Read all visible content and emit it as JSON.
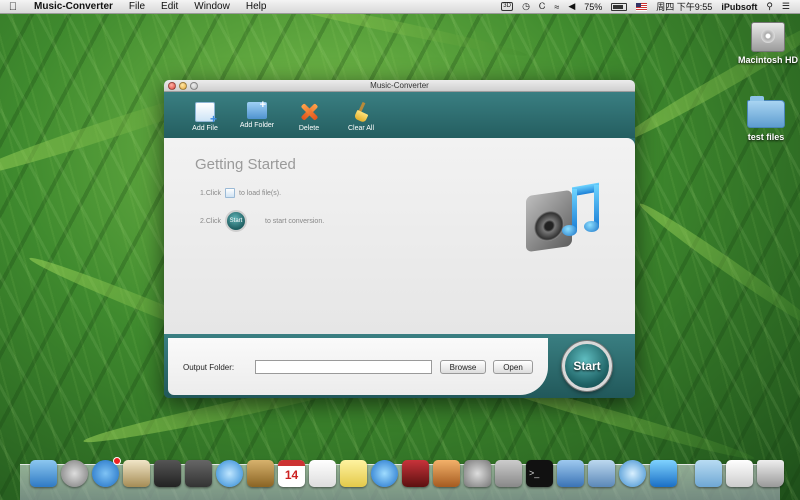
{
  "menubar": {
    "app_name": "Music-Converter",
    "menus": [
      "File",
      "Edit",
      "Window",
      "Help"
    ],
    "battery": "75%",
    "clock": "周四 下午9:55",
    "user": "iPubsoft",
    "search_icon": "magnifier-icon"
  },
  "desktop": {
    "icons": [
      {
        "label": "Macintosh HD",
        "icon": "hard-drive-icon"
      },
      {
        "label": "test files",
        "icon": "folder-icon"
      }
    ]
  },
  "window": {
    "title": "Music-Converter",
    "toolbar": {
      "add_file": "Add File",
      "add_folder": "Add Folder",
      "delete": "Delete",
      "clear_all": "Clear All"
    },
    "getting_started": {
      "title": "Getting Started",
      "step1_prefix": "1.Click",
      "step1_suffix": "to load file(s).",
      "step2_prefix": "2.Click",
      "step2_button": "Start",
      "step2_suffix": "to start conversion."
    },
    "output": {
      "label": "Output Folder:",
      "value": "",
      "browse": "Browse",
      "open": "Open",
      "start": "Start"
    }
  },
  "dock": {
    "calendar_day": "14",
    "terminal_prompt": ">_",
    "apps": [
      "finder",
      "launchpad",
      "app-store",
      "preview",
      "photo-booth",
      "facetime",
      "safari",
      "address-book",
      "calendar",
      "reminders",
      "notes",
      "itunes",
      "photo-booth-2",
      "iphoto",
      "system-preferences",
      "keychain",
      "terminal",
      "xcode",
      "preview-2",
      "network",
      "music-converter",
      "downloads",
      "mail-folder",
      "trash"
    ]
  },
  "colors": {
    "window_teal": "#2f6f71",
    "menubar": "#e6e6e6",
    "content_bg": "#efefef"
  }
}
